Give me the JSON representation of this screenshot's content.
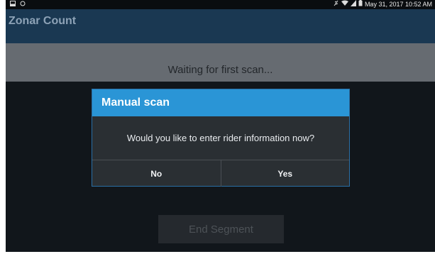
{
  "status_bar": {
    "left_icons": [
      "screenshot-icon",
      "sync-icon"
    ],
    "right_icons": [
      "vibrate-icon",
      "wifi-icon",
      "signal-icon",
      "battery-icon"
    ],
    "datetime": "May 31, 2017 10:52 AM"
  },
  "app": {
    "title": "Zonar Count"
  },
  "banner": {
    "message": "Waiting for first scan..."
  },
  "dialog": {
    "title": "Manual scan",
    "message": "Would you like to enter rider information now?",
    "buttons": {
      "no": "No",
      "yes": "Yes"
    }
  },
  "footer": {
    "end_segment_label": "End Segment"
  },
  "colors": {
    "dialog_header": "#2a95d6",
    "app_bar": "#1a3852",
    "banner": "#666b71"
  }
}
